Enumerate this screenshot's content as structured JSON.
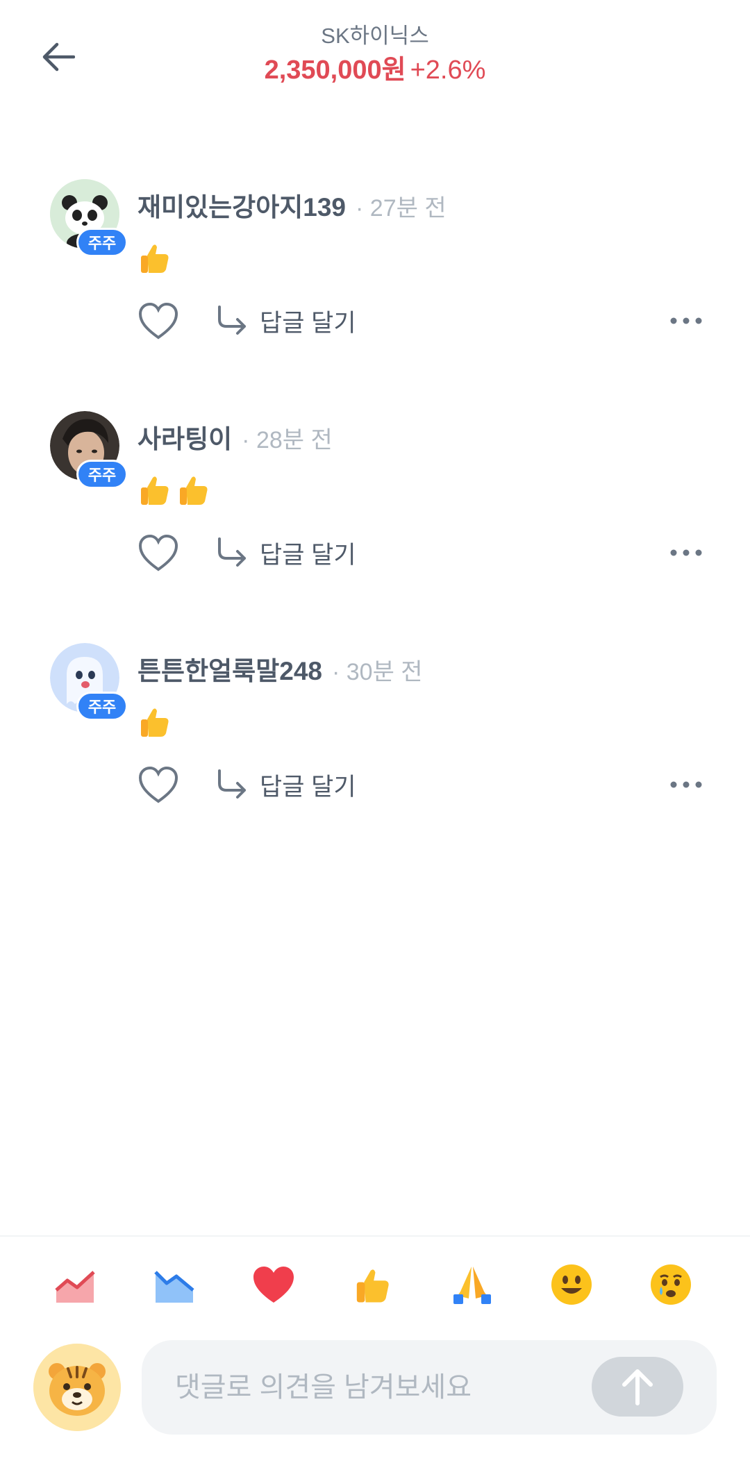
{
  "header": {
    "back_icon": "arrow-left-icon",
    "stock_name": "SK하이닉스",
    "price": "2,350,000원",
    "change": "+2.6%",
    "price_color": "#e04a55"
  },
  "comments": [
    {
      "author": "재미있는강아지139",
      "time": "· 27분 전",
      "badge": "주주",
      "avatar": "panda-avatar",
      "emojis": [
        "thumbs-up"
      ],
      "reply_label": "답글 달기"
    },
    {
      "author": "사라팅이",
      "time": "· 28분 전",
      "badge": "주주",
      "avatar": "photo-avatar",
      "emojis": [
        "thumbs-up",
        "thumbs-up"
      ],
      "reply_label": "답글 달기"
    },
    {
      "author": "튼튼한얼룩말248",
      "time": "· 30분 전",
      "badge": "주주",
      "avatar": "ghost-avatar",
      "emojis": [
        "thumbs-up"
      ],
      "reply_label": "답글 달기"
    }
  ],
  "reactions": [
    "chart-up-icon",
    "chart-down-icon",
    "heart-icon",
    "thumbs-up-icon",
    "praying-hands-icon",
    "smile-icon",
    "crying-face-icon"
  ],
  "composer": {
    "placeholder": "댓글로 의견을 남겨보세요",
    "avatar": "tiger-avatar",
    "send_icon": "arrow-up-icon"
  },
  "colors": {
    "badge_blue": "#3182f6",
    "text_primary": "#4e5968",
    "text_secondary": "#b0b8c1"
  }
}
